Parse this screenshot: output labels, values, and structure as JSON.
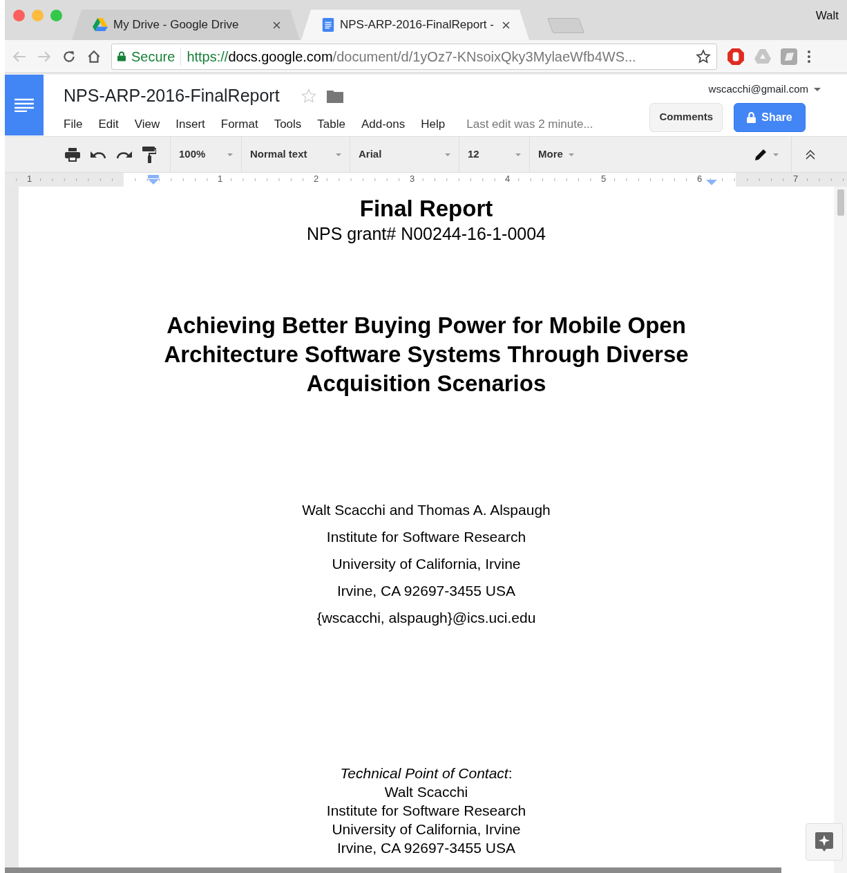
{
  "browser": {
    "tabs": [
      {
        "title": "My Drive - Google Drive",
        "selected": false
      },
      {
        "title": "NPS-ARP-2016-FinalReport -",
        "selected": true
      }
    ],
    "profile": "Walt",
    "address": {
      "secure_label": "Secure",
      "scheme": "https://",
      "host": "docs.google.com",
      "path": "/document/d/1yOz7-KNsoixQky3MylaeWfb4WS..."
    }
  },
  "docs": {
    "file_name": "NPS-ARP-2016-FinalReport",
    "starred": false,
    "account": "wscacchi@gmail.com",
    "menus": [
      "File",
      "Edit",
      "View",
      "Insert",
      "Format",
      "Tools",
      "Table",
      "Add-ons",
      "Help"
    ],
    "last_edit": "Last edit was 2 minute...",
    "comments_button": "Comments",
    "share_button": "Share",
    "toolbar": {
      "zoom": "100%",
      "style": "Normal text",
      "font": "Arial",
      "size": "12",
      "more": "More"
    },
    "ruler": [
      "1",
      "1",
      "2",
      "3",
      "4",
      "5",
      "6",
      "7"
    ]
  },
  "document": [
    {
      "kind": "title",
      "text": "Final Report"
    },
    {
      "kind": "subtitle",
      "text": "NPS grant# N00244-16-1-0004"
    },
    {
      "kind": "heading",
      "text": "Achieving Better Buying Power for Mobile Open Architecture Software Systems Through Diverse Acquisition Scenarios"
    },
    {
      "kind": "line",
      "text": "Walt Scacchi and Thomas A. Alspaugh"
    },
    {
      "kind": "line",
      "text": "Institute for Software Research"
    },
    {
      "kind": "line",
      "text": "University of California, Irvine"
    },
    {
      "kind": "line",
      "text": "Irvine, CA 92697-3455 USA"
    },
    {
      "kind": "line",
      "text": "{wscacchi, alspaugh}@ics.uci.edu"
    },
    {
      "kind": "contact",
      "text": "*Technical Point of Contact*:"
    },
    {
      "kind": "contact",
      "text": "Walt Scacchi"
    },
    {
      "kind": "contact",
      "text": "Institute for Software Research"
    },
    {
      "kind": "contact",
      "text": "University of California, Irvine"
    },
    {
      "kind": "contact",
      "text": "Irvine, CA 92697-3455 USA"
    }
  ]
}
